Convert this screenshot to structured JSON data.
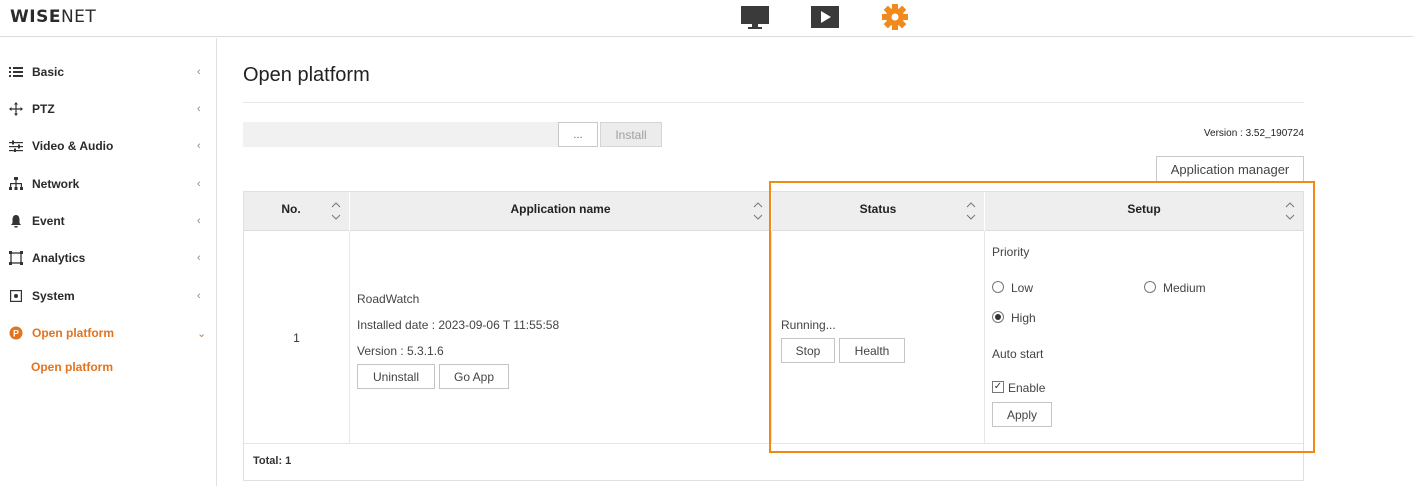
{
  "brand": {
    "logo_bold": "WISE",
    "logo_thin": "NET"
  },
  "topnav": {
    "icons": [
      "monitor-icon",
      "play-icon",
      "gear-icon"
    ],
    "active_color": "#f08a1c"
  },
  "sidebar": {
    "items": [
      {
        "label": "Basic",
        "icon": "list-icon"
      },
      {
        "label": "PTZ",
        "icon": "move-icon"
      },
      {
        "label": "Video & Audio",
        "icon": "sliders-icon"
      },
      {
        "label": "Network",
        "icon": "network-icon"
      },
      {
        "label": "Event",
        "icon": "bell-icon"
      },
      {
        "label": "Analytics",
        "icon": "frame-icon"
      },
      {
        "label": "System",
        "icon": "system-icon"
      },
      {
        "label": "Open platform",
        "icon": "open-platform-icon",
        "active": true
      }
    ],
    "sub_item": "Open platform",
    "chevron_collapsed": "‹",
    "chevron_expanded": "⌄"
  },
  "main": {
    "title": "Open platform",
    "browse_label": "...",
    "install_label": "Install",
    "version_text": "Version : 3.52_190724",
    "app_manager_label": "Application manager",
    "table": {
      "headers": {
        "no": "No.",
        "app_name": "Application name",
        "status": "Status",
        "setup": "Setup"
      },
      "row": {
        "no": "1",
        "app_name": "RoadWatch",
        "installed": "Installed date : 2023-09-06 T 11:55:58",
        "version": "Version : 5.3.1.6",
        "uninstall_label": "Uninstall",
        "go_app_label": "Go App",
        "status": "Running...",
        "stop_label": "Stop",
        "health_label": "Health",
        "priority_label": "Priority",
        "priority_options": {
          "low": "Low",
          "medium": "Medium",
          "high": "High"
        },
        "priority_selected": "High",
        "auto_start_label": "Auto start",
        "enable_label": "Enable",
        "enable_checked": true,
        "apply_label": "Apply"
      },
      "total": "Total: 1"
    }
  },
  "colors": {
    "accent": "#e2731f",
    "highlight": "#ef8a17",
    "header_bg": "#eeeeee"
  }
}
